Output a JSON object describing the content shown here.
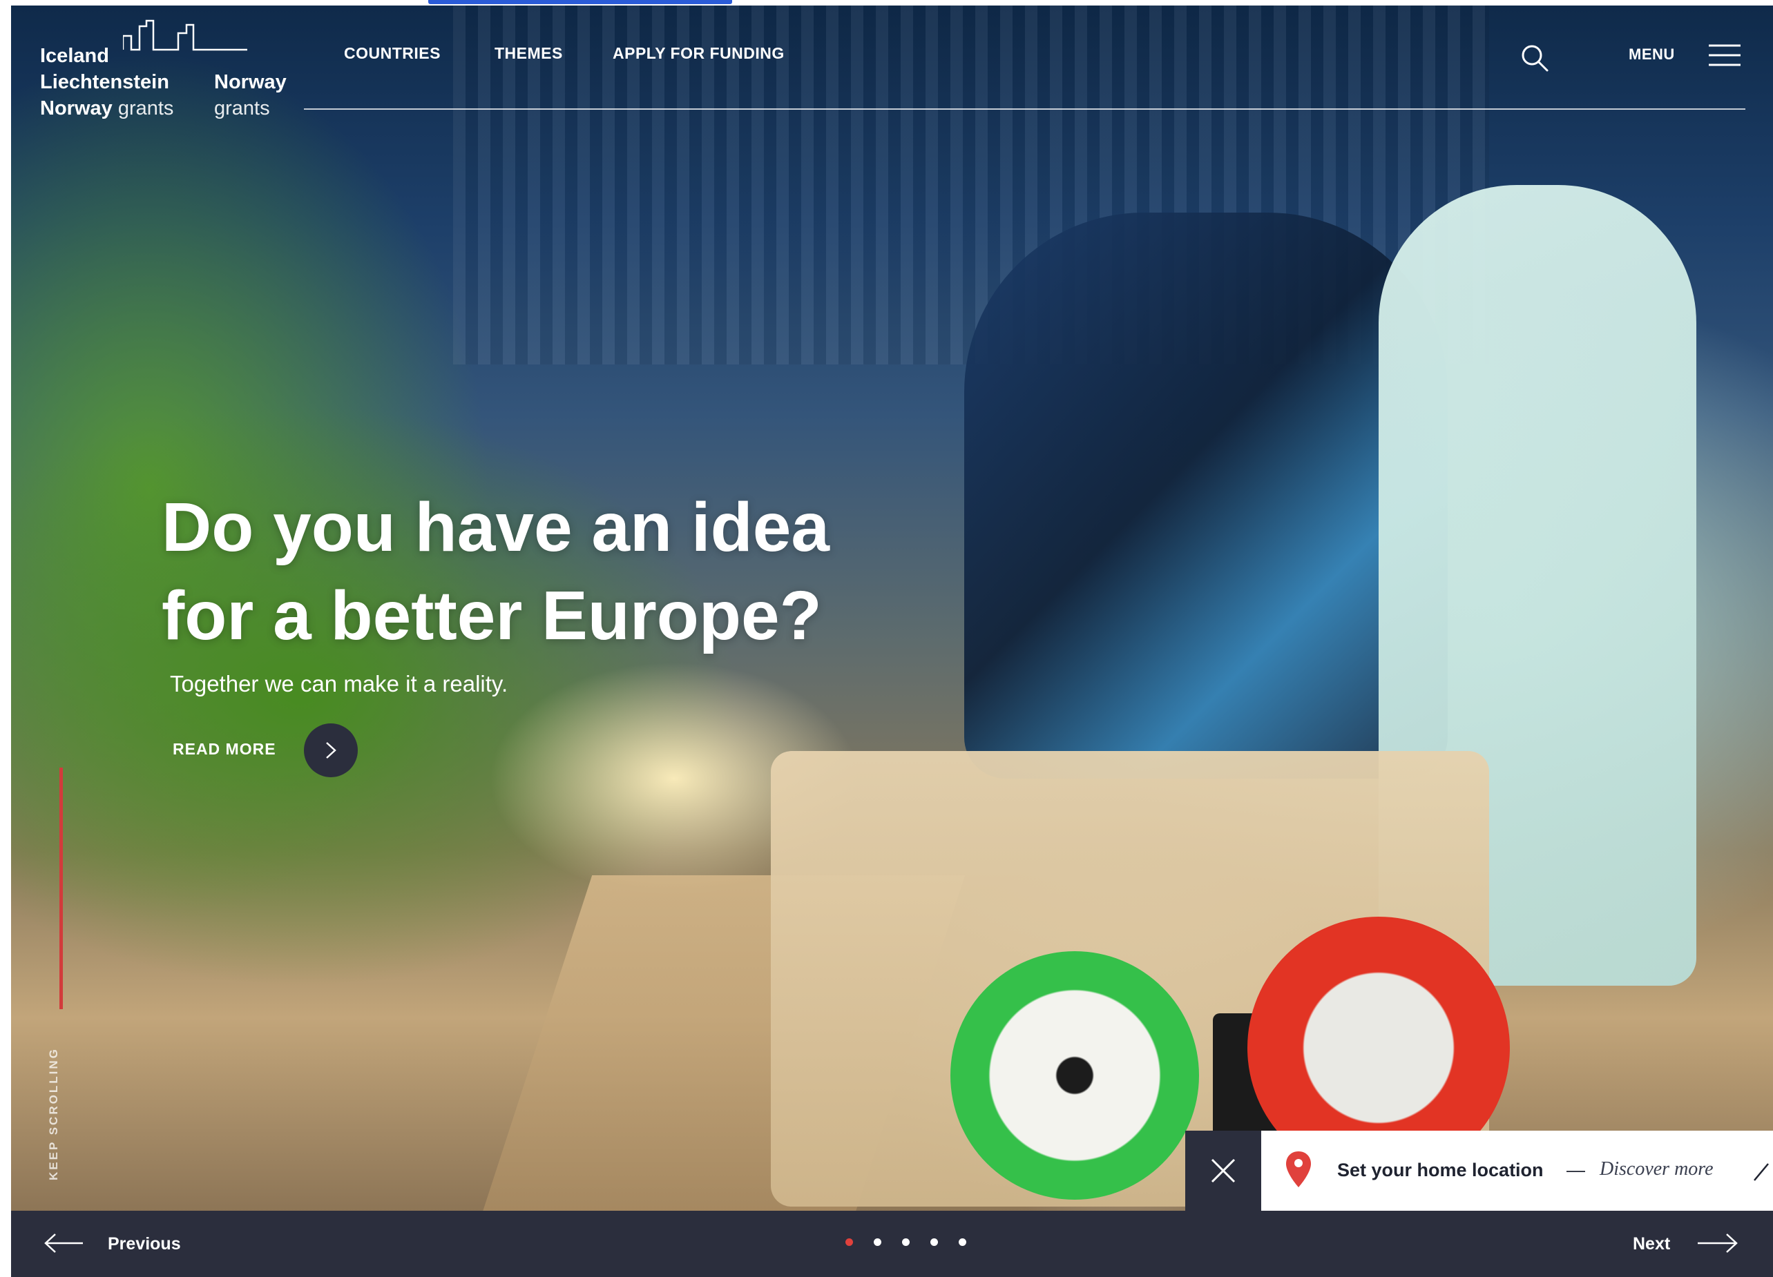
{
  "logo": {
    "line1": "Iceland",
    "line2": "Liechtenstein",
    "line3_bold": "Norway",
    "line3_light": "grants",
    "col2_line1": "Norway",
    "col2_line2": "grants"
  },
  "nav": {
    "items": [
      "COUNTRIES",
      "THEMES",
      "APPLY FOR FUNDING"
    ],
    "menu_label": "MENU"
  },
  "hero": {
    "title_line1": "Do you have an idea",
    "title_line2": "for a better Europe?",
    "subtitle": "Together we can make it a reality.",
    "read_more": "READ MORE"
  },
  "scroll": {
    "label": "KEEP SCROLLING"
  },
  "location_bar": {
    "text": "Set your home location",
    "dash": "—",
    "link": "Discover more"
  },
  "slider": {
    "previous": "Previous",
    "next": "Next",
    "dot_count": 5,
    "active_dot": 0
  },
  "colors": {
    "dark": "#2b2e3d",
    "accent_red": "#e0413c",
    "white": "#ffffff"
  }
}
